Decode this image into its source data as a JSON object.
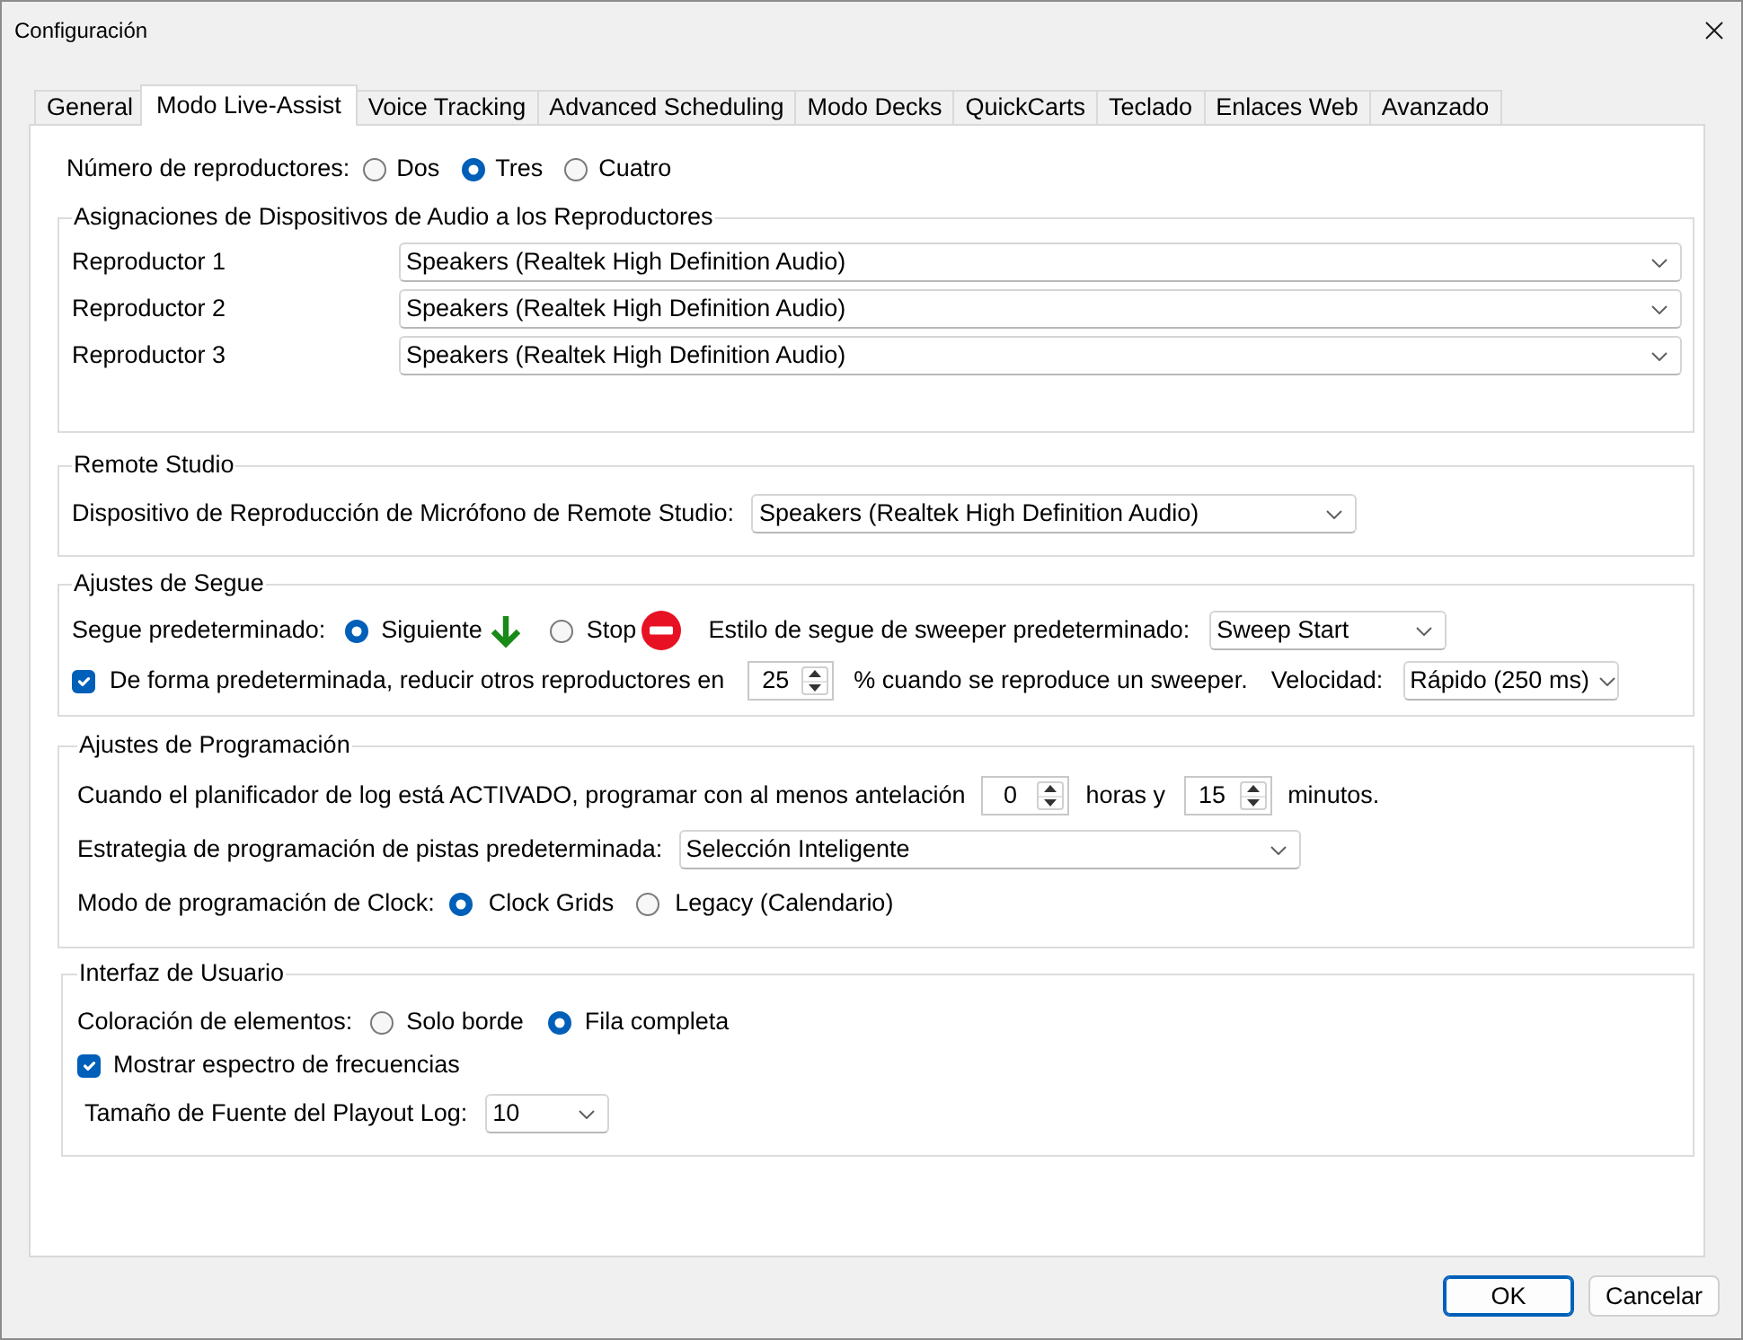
{
  "window": {
    "title": "Configuración"
  },
  "tabs": [
    {
      "label": "General",
      "selected": false
    },
    {
      "label": "Modo Live-Assist",
      "selected": true
    },
    {
      "label": "Voice Tracking",
      "selected": false
    },
    {
      "label": "Advanced Scheduling",
      "selected": false
    },
    {
      "label": "Modo Decks",
      "selected": false
    },
    {
      "label": "QuickCarts",
      "selected": false
    },
    {
      "label": "Teclado",
      "selected": false
    },
    {
      "label": "Enlaces Web",
      "selected": false
    },
    {
      "label": "Avanzado",
      "selected": false
    }
  ],
  "players": {
    "label": "Número de reproductores:",
    "options": [
      {
        "label": "Dos",
        "selected": false
      },
      {
        "label": "Tres",
        "selected": true
      },
      {
        "label": "Cuatro",
        "selected": false
      }
    ]
  },
  "audio_assignments": {
    "title": "Asignaciones de Dispositivos de Audio a los Reproductores",
    "rows": [
      {
        "label": "Reproductor 1",
        "value": "Speakers (Realtek High Definition Audio)"
      },
      {
        "label": "Reproductor 2",
        "value": "Speakers (Realtek High Definition Audio)"
      },
      {
        "label": "Reproductor 3",
        "value": "Speakers (Realtek High Definition Audio)"
      }
    ]
  },
  "remote_studio": {
    "title": "Remote Studio",
    "label": "Dispositivo de Reproducción de Micrófono de Remote Studio:",
    "value": "Speakers (Realtek High Definition Audio)"
  },
  "segue": {
    "title": "Ajustes de Segue",
    "default_label": "Segue predeterminado:",
    "default_options": [
      {
        "label": "Siguiente",
        "selected": true,
        "kind": "next"
      },
      {
        "label": "Stop",
        "selected": false,
        "kind": "stop"
      }
    ],
    "sweeper_label": "Estilo de segue de sweeper predeterminado:",
    "sweeper_value": "Sweep Start",
    "reduce": {
      "checked": true,
      "label": "De forma predeterminada, reducir otros reproductores en",
      "value": "25",
      "suffix": "% cuando se reproduce un sweeper."
    },
    "speed_label": "Velocidad:",
    "speed_value": "Rápido (250 ms)"
  },
  "scheduling": {
    "title": "Ajustes de Programación",
    "lead_label": "Cuando el planificador de log está ACTIVADO, programar con al menos antelación",
    "hours": "0",
    "hours_label": "horas y",
    "minutes": "15",
    "minutes_label": "minutos.",
    "strategy_label": "Estrategia de programación de pistas predeterminada:",
    "strategy_value": "Selección Inteligente",
    "clock_label": "Modo de programación de Clock:",
    "clock_options": [
      {
        "label": "Clock Grids",
        "selected": true
      },
      {
        "label": "Legacy (Calendario)",
        "selected": false
      }
    ]
  },
  "user_interface": {
    "title": "Interfaz de Usuario",
    "coloring_label": "Coloración de elementos:",
    "coloring_options": [
      {
        "label": "Solo borde",
        "selected": false
      },
      {
        "label": "Fila completa",
        "selected": true
      }
    ],
    "spectrum": {
      "checked": true,
      "label": "Mostrar espectro de frecuencias"
    },
    "font_size_label": "Tamaño de Fuente del Playout Log:",
    "font_size_value": "10"
  },
  "buttons": [
    {
      "label": "OK",
      "default": true
    },
    {
      "label": "Cancelar",
      "default": false
    }
  ]
}
